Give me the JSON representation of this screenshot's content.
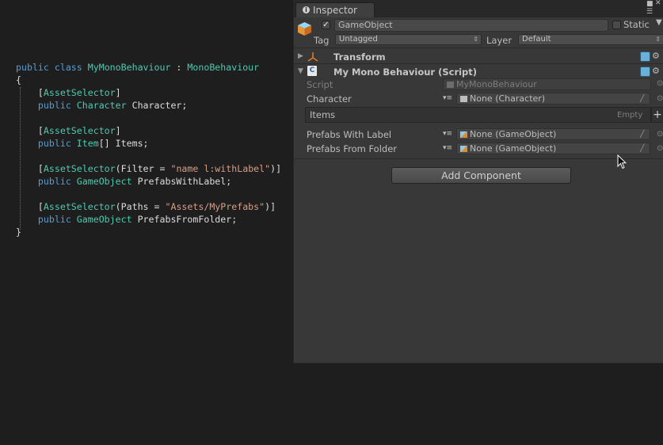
{
  "code": {
    "lines": [
      [
        {
          "c": "kw",
          "t": "public class "
        },
        {
          "c": "ty",
          "t": "MyMonoBehaviour"
        },
        {
          "c": "pl",
          "t": " : "
        },
        {
          "c": "ty",
          "t": "MonoBehaviour"
        }
      ],
      [
        {
          "c": "pl",
          "t": "{"
        }
      ],
      [
        {
          "c": "pl",
          "t": "    ["
        },
        {
          "c": "ty",
          "t": "AssetSelector"
        },
        {
          "c": "pl",
          "t": "]"
        }
      ],
      [
        {
          "c": "kw",
          "t": "    public "
        },
        {
          "c": "ty",
          "t": "Character"
        },
        {
          "c": "pl",
          "t": " Character;"
        }
      ],
      [
        {
          "c": "pl",
          "t": ""
        }
      ],
      [
        {
          "c": "pl",
          "t": "    ["
        },
        {
          "c": "ty",
          "t": "AssetSelector"
        },
        {
          "c": "pl",
          "t": "]"
        }
      ],
      [
        {
          "c": "kw",
          "t": "    public "
        },
        {
          "c": "ty",
          "t": "Item"
        },
        {
          "c": "pl",
          "t": "[] Items;"
        }
      ],
      [
        {
          "c": "pl",
          "t": ""
        }
      ],
      [
        {
          "c": "pl",
          "t": "    ["
        },
        {
          "c": "ty",
          "t": "AssetSelector"
        },
        {
          "c": "pl",
          "t": "(Filter = "
        },
        {
          "c": "st",
          "t": "\"name l:withLabel\""
        },
        {
          "c": "pl",
          "t": ")]"
        }
      ],
      [
        {
          "c": "kw",
          "t": "    public "
        },
        {
          "c": "ty",
          "t": "GameObject"
        },
        {
          "c": "pl",
          "t": " PrefabsWithLabel;"
        }
      ],
      [
        {
          "c": "pl",
          "t": ""
        }
      ],
      [
        {
          "c": "pl",
          "t": "    ["
        },
        {
          "c": "ty",
          "t": "AssetSelector"
        },
        {
          "c": "pl",
          "t": "(Paths = "
        },
        {
          "c": "st",
          "t": "\"Assets/MyPrefabs\""
        },
        {
          "c": "pl",
          "t": ")]"
        }
      ],
      [
        {
          "c": "kw",
          "t": "    public "
        },
        {
          "c": "ty",
          "t": "GameObject"
        },
        {
          "c": "pl",
          "t": " PrefabsFromFolder;"
        }
      ],
      [
        {
          "c": "pl",
          "t": "}"
        }
      ]
    ]
  },
  "inspector": {
    "tab_label": "Inspector",
    "object_name": "GameObject",
    "static_label": "Static",
    "tag_label": "Tag",
    "tag_value": "Untagged",
    "layer_label": "Layer",
    "layer_value": "Default",
    "transform_title": "Transform",
    "script_component_title": "My Mono Behaviour (Script)",
    "script_label": "Script",
    "script_value": "MyMonoBehaviour",
    "character_label": "Character",
    "character_value": "None (Character)",
    "items_label": "Items",
    "items_empty": "Empty",
    "prefabs_with_label_label": "Prefabs With Label",
    "prefabs_with_label_value": "None (GameObject)",
    "prefabs_from_folder_label": "Prefabs From Folder",
    "prefabs_from_folder_value": "None (GameObject)",
    "add_component_label": "Add Component"
  },
  "colors": {
    "keyword": "#569cd6",
    "type": "#4ec9b0",
    "string": "#d69d85",
    "editor_bg": "#1e1e1e",
    "inspector_bg": "#383838"
  }
}
